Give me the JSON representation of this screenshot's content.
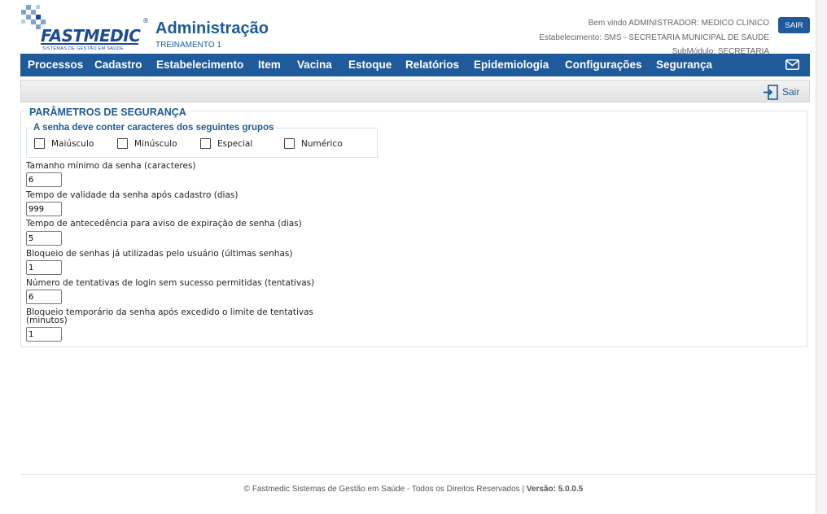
{
  "brand": {
    "name": "FASTMEDIC",
    "registered": "®",
    "tagline": "SISTEMAS DE GESTÃO EM SAÚDE"
  },
  "header": {
    "title": "Administração",
    "subtitle": "TREINAMENTO 1",
    "welcome": "Bem vindo ADMINISTRADOR: MEDICO CLINICO",
    "establishment": "Estabelecimento: SMS - SECRETARIA MUNICIPAL DE SAUDE",
    "submodule": "SubMódulo: SECRETARIA",
    "logout_label": "SAIR"
  },
  "nav": {
    "items": [
      "Processos",
      "Cadastro",
      "Estabelecimento",
      "Item",
      "Vacina",
      "Estoque",
      "Relatórios",
      "Epidemiologia",
      "Configurações",
      "Segurança"
    ],
    "mail_icon": "envelope-icon"
  },
  "toolbar": {
    "exit_label": "Sair",
    "exit_icon": "exit-door-icon"
  },
  "form": {
    "title": "PARÂMETROS DE SEGURANÇA",
    "group_title": "A senha deve conter caracteres dos seguintes grupos",
    "checkboxes": [
      {
        "label": "Maiúsculo",
        "checked": false
      },
      {
        "label": "Minúsculo",
        "checked": false
      },
      {
        "label": "Especial",
        "checked": false
      },
      {
        "label": "Numérico",
        "checked": false
      }
    ],
    "fields": [
      {
        "label": "Tamanho mínimo da senha (caracteres)",
        "value": "6"
      },
      {
        "label": "Tempo de validade da senha após cadastro (dias)",
        "value": "999"
      },
      {
        "label": "Tempo de antecedência para aviso de expiração de senha (dias)",
        "value": "5"
      },
      {
        "label": "Bloqueio de senhas já utilizadas pelo usuário (últimas senhas)",
        "value": "1"
      },
      {
        "label": "Número de tentativas de login sem sucesso permitidas (tentativas)",
        "value": "6"
      },
      {
        "label": "Bloqueio temporário da senha após excedido o limite de tentativas",
        "label2": "(minutos)",
        "value": "1"
      }
    ]
  },
  "footer": {
    "text": "© Fastmedic Sistemas de Gestão em Saúde - Todos os Direitos Reservados | ",
    "version": "Versão: 5.0.0.5"
  },
  "colors": {
    "primary": "#1f5b9b",
    "title": "#1c5a96"
  }
}
